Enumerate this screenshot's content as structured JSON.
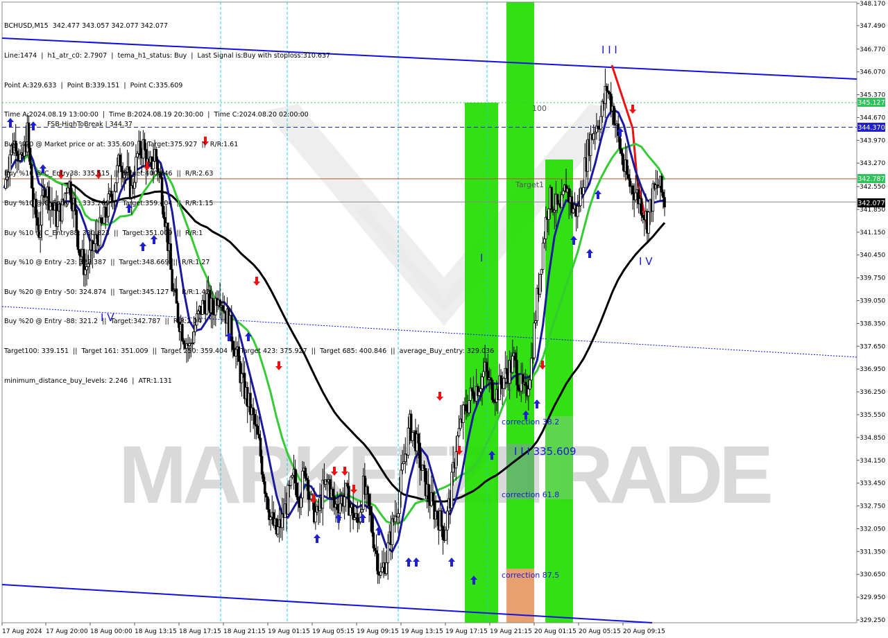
{
  "colors": {
    "background": "#ffffff",
    "candle": "#000000",
    "ma_black": "#000000",
    "ma_blue": "#1a1aa0",
    "ma_green": "#33cc33",
    "channel": "#1010e0",
    "green_zone": "#22dd00",
    "orange_zone": "#e8a070",
    "red_line": "#ee1111",
    "price_tag_current": "#000000",
    "price_tag_green": "#2ec45a",
    "price_tag_blue": "#1f1fd0",
    "price_tag_brown": "#b0562a",
    "watermark": "#d4d4d4"
  },
  "header": {
    "lines": [
      "BCHUSD,M15  342.477 343.057 342.077 342.077",
      "Line:1474  |  h1_atr_c0: 2.7907  |  tema_h1_status: Buy  |  Last Signal is:Buy with stoploss:310.637",
      "Point A:329.633  |  Point B:339.151  |  Point C:335.609",
      "Time A:2024.08.19 13:00:00  |  Time B:2024.08.19 20:30:00  |  Time C:2024.08.20 02:00:00",
      "Buy %20 @ Market price or at: 335.609  ||  Target:375.927  ||  R/R:1.61",
      "Buy %10 @ C_Entry38: 335.515  ||  Target:400.846  ||  R/R:2.63",
      "Buy %10 @ C_Entry61: 333.269  ||  Target:359.404  ||  R/R:1.15",
      "Buy %10 @ C_Entry88: 330.823  ||  Target:351.009  ||  R/R:1",
      "Buy %10 @ Entry -23: 327.387  ||  Target:348.669  ||  R/R:1.27",
      "Buy %20 @ Entry -50: 324.874  ||  Target:345.127  ||  R/R:1.42",
      "Buy %20 @ Entry -88: 321.2  ||  Target:342.787  ||  R/R:2.04",
      "Target100: 339.151  ||  Target 161: 351.009  ||  Target 250: 359.404  ||  Target 423: 375.927  ||  Target 685: 400.846  ||  average_Buy_entry: 329.036",
      "minimum_distance_buy_levels: 2.246  |  ATR:1.131"
    ]
  },
  "labels": {
    "fsb": "FSB-HighToBreak  |  344.37",
    "target1": "Target1",
    "hundred": "100",
    "wave_iv_left": "I V",
    "wave_i": "I",
    "wave_iii_top": "I I I",
    "wave_iv_right": "I V",
    "wave_iii_value": "I I I 335.609",
    "corr382": "correction 38.2",
    "corr618": "correction 61.8",
    "corr875": "correction 87.5",
    "watermark": "MARKETZITRADE"
  },
  "price_tags": {
    "p345127": "345.127",
    "p344370": "344.370",
    "p342787": "342.787",
    "p342077": "342.077"
  },
  "chart_data": {
    "type": "candlestick",
    "symbol": "BCHUSD",
    "timeframe": "M15",
    "ylim": [
      329.25,
      348.17
    ],
    "y_ticks": [
      "348.170",
      "347.490",
      "346.770",
      "346.070",
      "345.370",
      "344.670",
      "343.970",
      "343.270",
      "342.550",
      "341.850",
      "341.150",
      "340.450",
      "339.750",
      "339.050",
      "338.350",
      "337.650",
      "336.950",
      "336.250",
      "335.550",
      "334.850",
      "334.150",
      "333.450",
      "332.750",
      "332.050",
      "331.350",
      "330.650",
      "329.950",
      "329.250"
    ],
    "x_ticks": [
      "17 Aug 2024",
      "17 Aug 20:00",
      "18 Aug 00:00",
      "18 Aug 13:15",
      "18 Aug 17:15",
      "18 Aug 21:15",
      "19 Aug 01:15",
      "19 Aug 05:15",
      "19 Aug 09:15",
      "19 Aug 13:15",
      "19 Aug 17:15",
      "19 Aug 21:15",
      "20 Aug 01:15",
      "20 Aug 05:15",
      "20 Aug 09:15"
    ],
    "horizontal_levels": [
      {
        "price": 345.127,
        "style": "dotted",
        "color": "#2ec45a"
      },
      {
        "price": 344.37,
        "style": "dashed",
        "color": "#1f1fd0"
      },
      {
        "price": 342.787,
        "style": "solid",
        "color": "#b0562a"
      },
      {
        "price": 342.077,
        "style": "solid",
        "color": "#888888"
      }
    ],
    "close_path": [
      342.5,
      343.6,
      344.0,
      343.2,
      344.2,
      342.0,
      341.2,
      342.6,
      342.1,
      341.6,
      341.9,
      342.8,
      342.0,
      340.6,
      340.0,
      340.5,
      341.0,
      341.4,
      342.0,
      342.6,
      343.4,
      343.0,
      342.4,
      343.5,
      343.8,
      343.0,
      343.6,
      342.7,
      341.3,
      339.5,
      338.6,
      338.0,
      337.6,
      338.3,
      338.8,
      339.1,
      338.7,
      339.4,
      338.8,
      338.2,
      337.5,
      336.6,
      336.0,
      335.4,
      334.6,
      333.4,
      332.4,
      331.9,
      332.3,
      333.0,
      333.6,
      333.1,
      333.9,
      332.8,
      332.4,
      333.2,
      333.5,
      332.7,
      332.9,
      333.1,
      332.6,
      332.2,
      333.3,
      332.6,
      331.5,
      330.6,
      331.2,
      332.1,
      332.9,
      334.1,
      335.2,
      334.8,
      333.9,
      333.2,
      332.7,
      332.4,
      331.9,
      333.0,
      334.6,
      335.4,
      335.9,
      336.3,
      336.5,
      336.9,
      336.4,
      336.2,
      336.6,
      336.9,
      337.2,
      336.5,
      336.1,
      337.2,
      339.1,
      340.8,
      342.2,
      342.0,
      341.7,
      342.6,
      341.9,
      341.8,
      342.9,
      343.9,
      344.4,
      344.7,
      345.6,
      345.0,
      344.0,
      343.1,
      342.6,
      342.4,
      342.0,
      341.5,
      342.3,
      342.6,
      342.1
    ],
    "moving_averages": [
      {
        "name": "MA200",
        "color": "#000000"
      },
      {
        "name": "MA50",
        "color": "#33cc33"
      },
      {
        "name": "MA20",
        "color": "#1a1aa0"
      }
    ],
    "zones": [
      {
        "label": "correction 38.2",
        "color": "#22dd00"
      },
      {
        "label": "correction 61.8",
        "color": "#22dd00"
      },
      {
        "label": "correction 87.5",
        "color": "#e8a070"
      }
    ]
  }
}
